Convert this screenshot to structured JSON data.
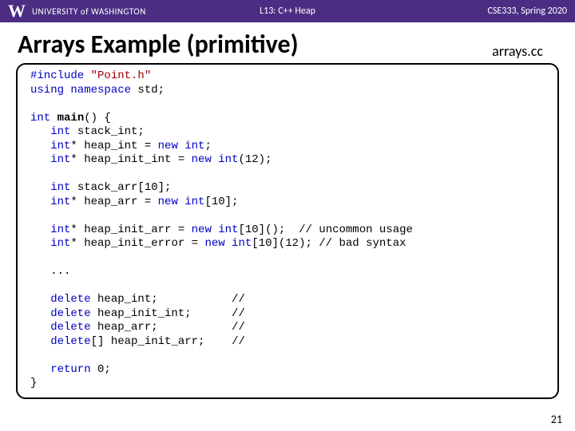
{
  "topbar": {
    "logo_letter": "W",
    "university": "UNIVERSITY of WASHINGTON",
    "lecture": "L13:  C++ Heap",
    "course": "CSE333, Spring 2020"
  },
  "title": "Arrays Example (primitive)",
  "filename": "arrays.cc",
  "code": {
    "l01a": "#include ",
    "l01b": "\"Point.h\"",
    "l02a": "using namespace ",
    "l02b": "std;",
    "l03": "",
    "l04a": "int ",
    "l04b": "main",
    "l04c": "() {",
    "l05a": "   int ",
    "l05b": "stack_int;",
    "l06a": "   int",
    "l06b": "* heap_int = ",
    "l06c": "new int",
    "l06d": ";",
    "l07a": "   int",
    "l07b": "* heap_init_int = ",
    "l07c": "new int",
    "l07d": "(12);",
    "l08": "",
    "l09a": "   int ",
    "l09b": "stack_arr[10];",
    "l10a": "   int",
    "l10b": "* heap_arr = ",
    "l10c": "new int",
    "l10d": "[10];",
    "l11": "",
    "l12a": "   int",
    "l12b": "* heap_init_arr = ",
    "l12c": "new int",
    "l12d": "[10]();  ",
    "l12e": "// uncommon usage",
    "l13a": "   int",
    "l13b": "* heap_init_error = ",
    "l13c": "new int",
    "l13d": "[10](12); ",
    "l13e": "// bad syntax",
    "l14": "",
    "l15": "   ...",
    "l16": "",
    "l17a": "   delete ",
    "l17b": "heap_int;           ",
    "l17c": "//",
    "l18a": "   delete ",
    "l18b": "heap_init_int;      ",
    "l18c": "//",
    "l19a": "   delete ",
    "l19b": "heap_arr;           ",
    "l19c": "//",
    "l20a": "   delete",
    "l20b": "[] heap_init_arr;    ",
    "l20c": "//",
    "l21": "",
    "l22a": "   return ",
    "l22b": "0;",
    "l23": "}"
  },
  "slidenum": "21"
}
